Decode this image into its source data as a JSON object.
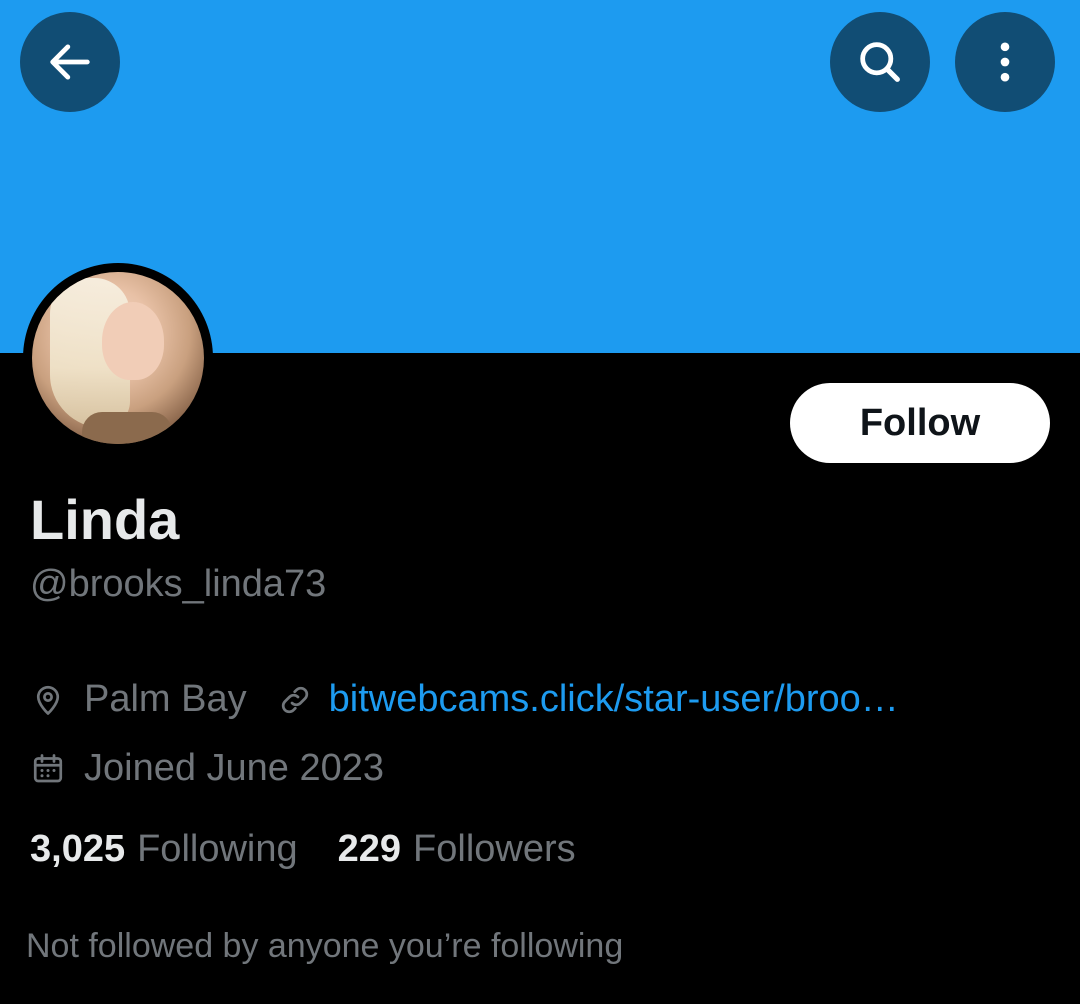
{
  "header": {
    "back_icon": "arrow-left-icon",
    "search_icon": "search-icon",
    "more_icon": "more-vertical-icon",
    "banner_color": "#1d9bf0",
    "button_color": "#114d74"
  },
  "profile": {
    "name": "Linda",
    "handle": "@brooks_linda73",
    "follow_label": "Follow",
    "location": "Palm Bay",
    "website": "bitwebcams.click/star-user/broo…",
    "joined": "Joined June 2023",
    "following_count": "3,025",
    "following_label": "Following",
    "followers_count": "229",
    "followers_label": "Followers",
    "mutuals_text": "Not followed by anyone you’re following"
  },
  "colors": {
    "background": "#000000",
    "primary_text": "#e7e9ea",
    "secondary_text": "#71767b",
    "link": "#1d9bf0"
  }
}
